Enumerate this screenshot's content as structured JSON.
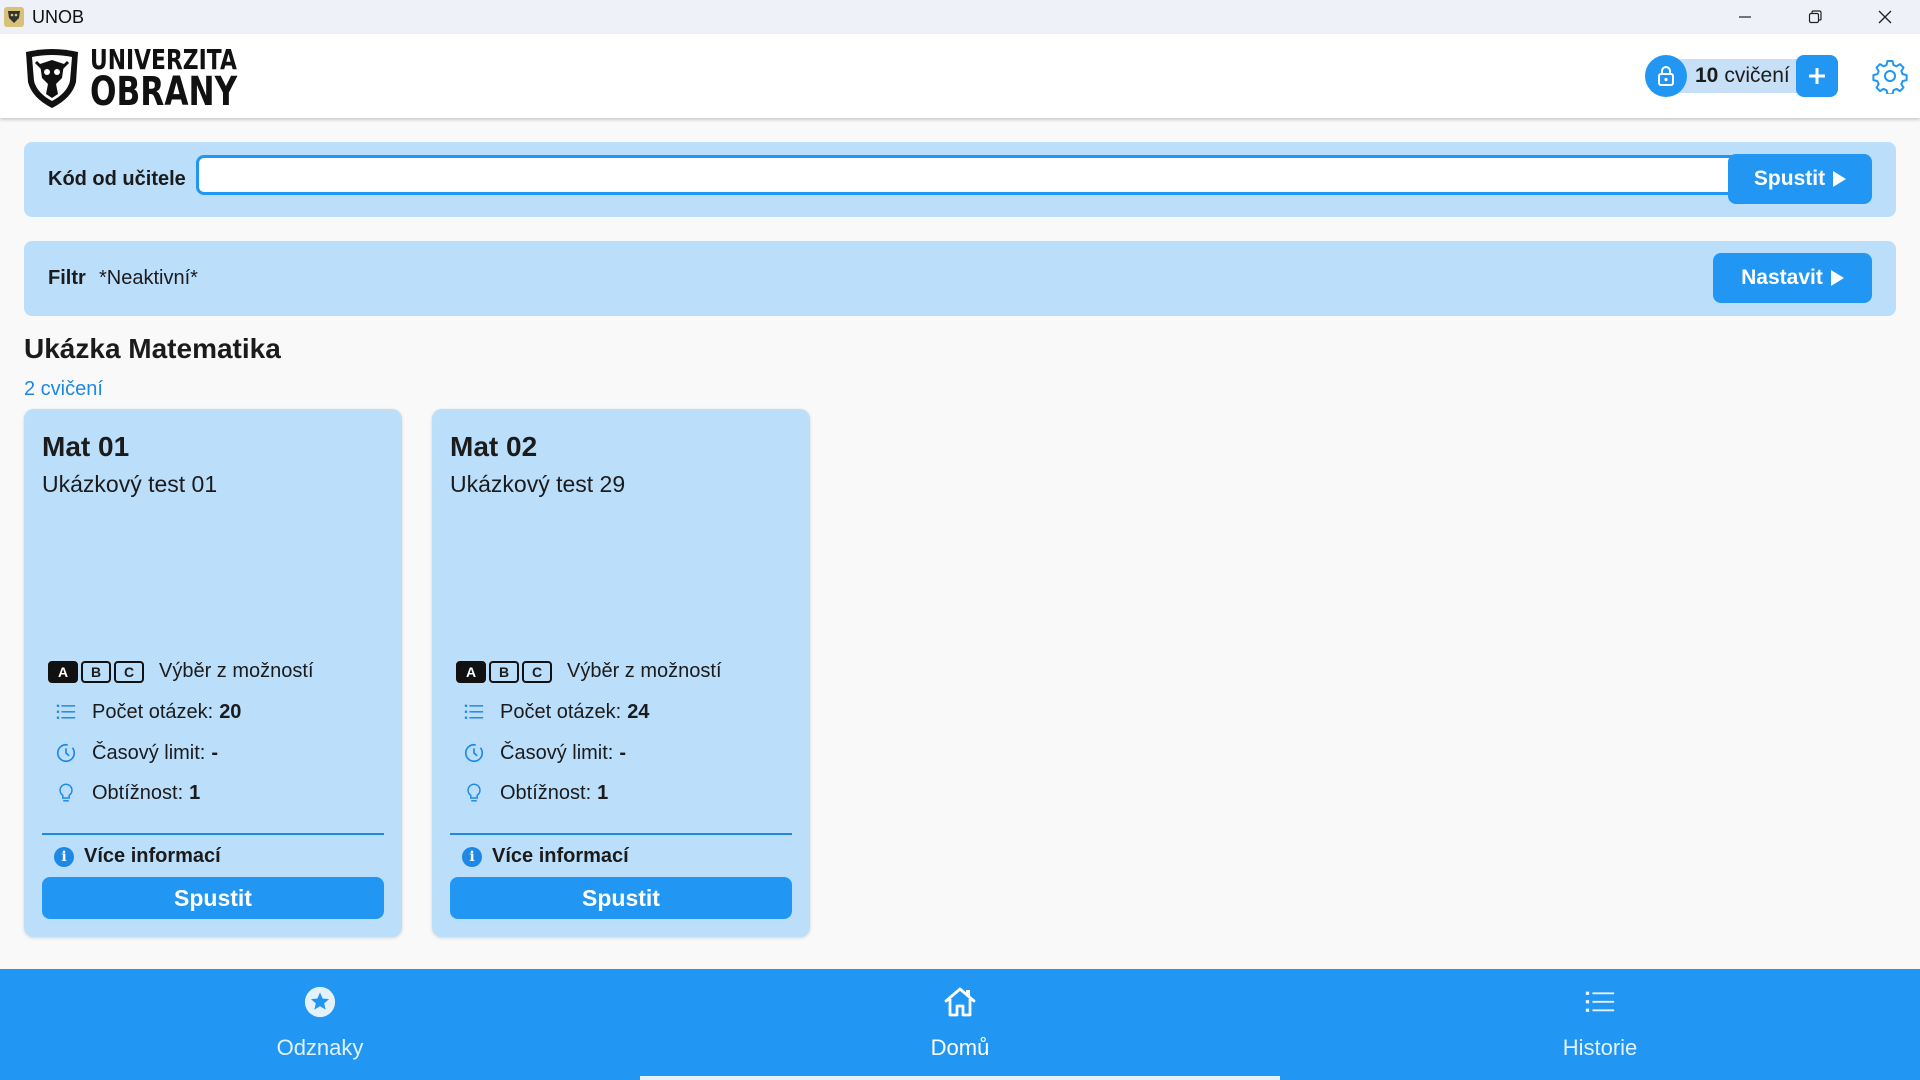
{
  "window": {
    "title": "UNOB",
    "icons": [
      "app-icon",
      "minimize-icon",
      "restore-icon",
      "close-icon"
    ]
  },
  "header": {
    "logo_line1": "UNIVERZITA",
    "logo_line2": "OBRANY",
    "credit_count": "10",
    "credit_unit": "cvičení",
    "icons": [
      "lock-icon",
      "plus-icon",
      "gear-icon"
    ]
  },
  "code_bar": {
    "label": "Kód od učitele",
    "input_value": "",
    "run_label": "Spustit"
  },
  "filter_bar": {
    "label": "Filtr",
    "value": "*Neaktivní*",
    "set_label": "Nastavit"
  },
  "section": {
    "title": "Ukázka Matematika",
    "count": "2 cvičení"
  },
  "cards": [
    {
      "title": "Mat 01",
      "subtitle": "Ukázkový test 01",
      "type_label": "Výběr z možností",
      "abc": [
        "A",
        "B",
        "C"
      ],
      "questions_label": "Počet otázek:",
      "questions_value": "20",
      "time_label": "Časový limit:",
      "time_value": "-",
      "difficulty_label": "Obtížnost:",
      "difficulty_value": "1",
      "more_label": "Více informací",
      "run_label": "Spustit"
    },
    {
      "title": "Mat 02",
      "subtitle": "Ukázkový test 29",
      "type_label": "Výběr z možností",
      "abc": [
        "A",
        "B",
        "C"
      ],
      "questions_label": "Počet otázek:",
      "questions_value": "24",
      "time_label": "Časový limit:",
      "time_value": "-",
      "difficulty_label": "Obtížnost:",
      "difficulty_value": "1",
      "more_label": "Více informací",
      "run_label": "Spustit"
    }
  ],
  "bottom_nav": {
    "items": [
      {
        "label": "Odznaky",
        "icon": "badge-star-icon",
        "active": false
      },
      {
        "label": "Domů",
        "icon": "home-icon",
        "active": true
      },
      {
        "label": "Historie",
        "icon": "list-icon",
        "active": false
      }
    ]
  },
  "colors": {
    "accent": "#2196f3",
    "panel": "#bbdefb",
    "background": "#f9f9f9"
  }
}
